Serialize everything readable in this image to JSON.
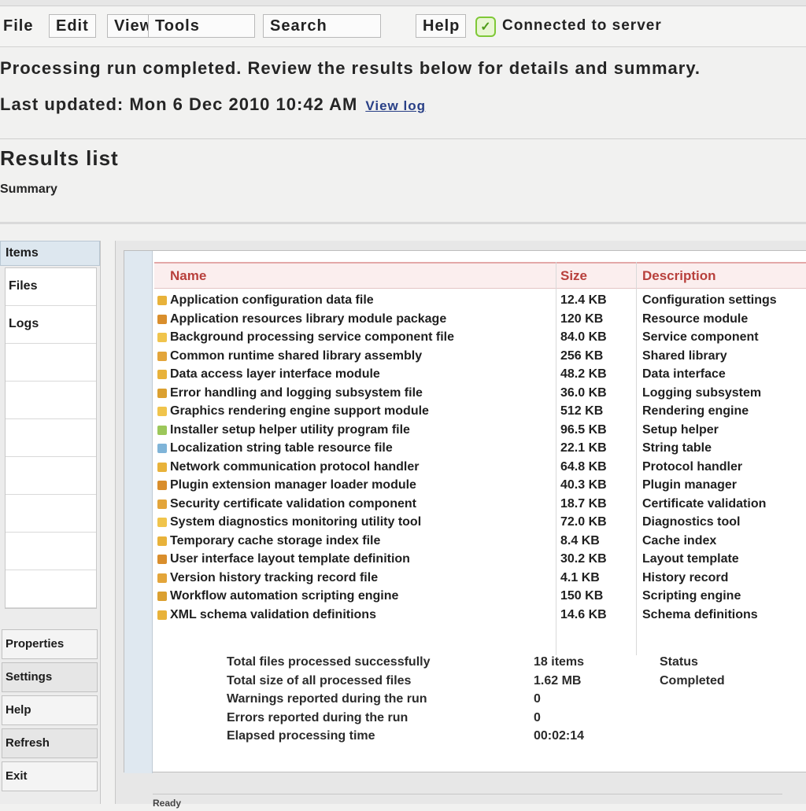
{
  "toolbar": {
    "items": [
      "File",
      "Edit",
      "View",
      "Tools"
    ],
    "field": "Search",
    "help": "Help",
    "ok_label": "✓",
    "status_text": "Connected to server"
  },
  "header": {
    "intro": "Processing run completed. Review the results below for details and summary.",
    "meta": "Last updated: Mon 6 Dec 2010 10:42 AM",
    "meta_link": "View log"
  },
  "section": {
    "title": "Results list",
    "subtitle": "Summary"
  },
  "left_nav": {
    "header": "Items",
    "rows": [
      "Files",
      "Logs",
      "",
      "",
      "",
      "",
      "",
      "",
      "",
      ""
    ],
    "buttons": [
      "Properties",
      "Settings",
      "Help",
      "Refresh",
      "Exit"
    ]
  },
  "table": {
    "columns": [
      "Name",
      "Size",
      "Description"
    ],
    "rows": [
      {
        "name": "Application configuration data file",
        "size": "12.4 KB",
        "desc": "Configuration settings"
      },
      {
        "name": "Application resources library module package",
        "size": "120 KB",
        "desc": "Resource module"
      },
      {
        "name": "Background processing service component file",
        "size": "84.0 KB",
        "desc": "Service component"
      },
      {
        "name": "Common runtime shared library assembly",
        "size": "256 KB",
        "desc": "Shared library"
      },
      {
        "name": "Data access layer interface module",
        "size": "48.2 KB",
        "desc": "Data interface"
      },
      {
        "name": "Error handling and logging subsystem file",
        "size": "36.0 KB",
        "desc": "Logging subsystem"
      },
      {
        "name": "Graphics rendering engine support module",
        "size": "512 KB",
        "desc": "Rendering engine"
      },
      {
        "name": "Installer setup helper utility program file",
        "size": "96.5 KB",
        "desc": "Setup helper"
      },
      {
        "name": "Localization string table resource file",
        "size": "22.1 KB",
        "desc": "String table"
      },
      {
        "name": "Network communication protocol handler",
        "size": "64.8 KB",
        "desc": "Protocol handler"
      },
      {
        "name": "Plugin extension manager loader module",
        "size": "40.3 KB",
        "desc": "Plugin manager"
      },
      {
        "name": "Security certificate validation component",
        "size": "18.7 KB",
        "desc": "Certificate validation"
      },
      {
        "name": "System diagnostics monitoring utility tool",
        "size": "72.0 KB",
        "desc": "Diagnostics tool"
      },
      {
        "name": "Temporary cache storage index file",
        "size": "8.4 KB",
        "desc": "Cache index"
      },
      {
        "name": "User interface layout template definition",
        "size": "30.2 KB",
        "desc": "Layout template"
      },
      {
        "name": "Version history tracking record file",
        "size": "4.1 KB",
        "desc": "History record"
      },
      {
        "name": "Workflow automation scripting engine",
        "size": "150 KB",
        "desc": "Scripting engine"
      },
      {
        "name": "XML schema validation definitions",
        "size": "14.6 KB",
        "desc": "Schema definitions"
      }
    ],
    "icon_colors": [
      "#e8b23a",
      "#d98e2c",
      "#f0c44c",
      "#e3a53a",
      "#e8b23a",
      "#dba030",
      "#f0c44c",
      "#9cc75a",
      "#7fb4d8",
      "#e8b23a",
      "#d98e2c",
      "#e3a53a",
      "#f0c44c",
      "#e8b23a",
      "#d98e2c",
      "#e3a53a",
      "#dba030",
      "#e8b23a"
    ]
  },
  "notes": [
    {
      "a": "Total files processed successfully",
      "b": "18 items",
      "c": "Status"
    },
    {
      "a": "Total size of all processed files",
      "b": "1.62 MB",
      "c": "Completed"
    },
    {
      "a": "Warnings reported during the run",
      "b": "0",
      "c": ""
    },
    {
      "a": "Errors reported during the run",
      "b": "0",
      "c": ""
    },
    {
      "a": "Elapsed processing time",
      "b": "00:02:14",
      "c": ""
    }
  ],
  "status_bar": "Ready"
}
